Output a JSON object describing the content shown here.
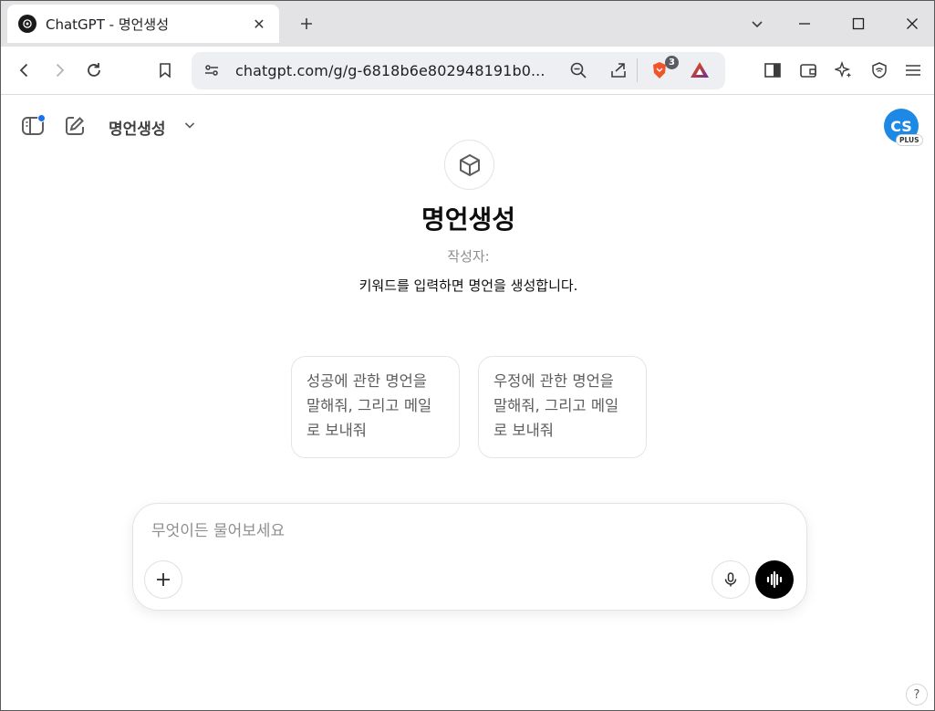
{
  "browser": {
    "tab": {
      "title": "ChatGPT - 명언생성",
      "close_label": "✕"
    },
    "new_tab_label": "+",
    "url": "chatgpt.com/g/g-6818b6e802948191b0...",
    "brave_shield_count": "3"
  },
  "header": {
    "model_name": "명언생성",
    "avatar_initials": "CS",
    "plan_badge": "PLUS"
  },
  "gpt": {
    "name": "명언생성",
    "author": "작성자: ",
    "description": "키워드를 입력하면 명언을 생성합니다."
  },
  "starters": [
    {
      "label": "성공에 관한 명언을 말해줘, 그리고 메일로 보내줘"
    },
    {
      "label": "우정에 관한 명언을 말해줘, 그리고 메일로 보내줘"
    }
  ],
  "composer": {
    "placeholder": "무엇이든 물어보세요"
  },
  "help_label": "?",
  "colors": {
    "avatar": "#1e88e5",
    "voice_button": "#000000",
    "notification_dot": "#1a73e8"
  }
}
